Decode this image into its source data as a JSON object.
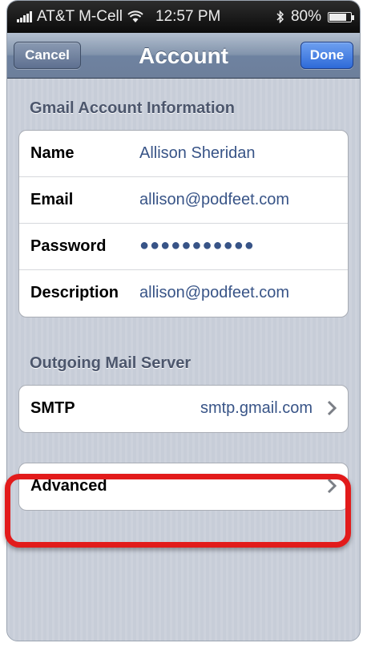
{
  "status_bar": {
    "carrier": "AT&T M-Cell",
    "time": "12:57 PM",
    "battery": "80%",
    "battery_level": 0.8
  },
  "nav": {
    "title": "Account",
    "cancel_label": "Cancel",
    "done_label": "Done"
  },
  "account_section": {
    "header": "Gmail Account Information",
    "rows": [
      {
        "label": "Name",
        "value": "Allison Sheridan"
      },
      {
        "label": "Email",
        "value": "allison@podfeet.com"
      },
      {
        "label": "Password",
        "value": "●●●●●●●●●●●"
      },
      {
        "label": "Description",
        "value": "allison@podfeet.com"
      }
    ]
  },
  "outgoing_section": {
    "header": "Outgoing Mail Server",
    "smtp_label": "SMTP",
    "smtp_value": "smtp.gmail.com"
  },
  "advanced": {
    "label": "Advanced"
  },
  "colors": {
    "highlight": "#e21b1b",
    "value_text": "#385487",
    "done_button": "#2e6ad8"
  }
}
